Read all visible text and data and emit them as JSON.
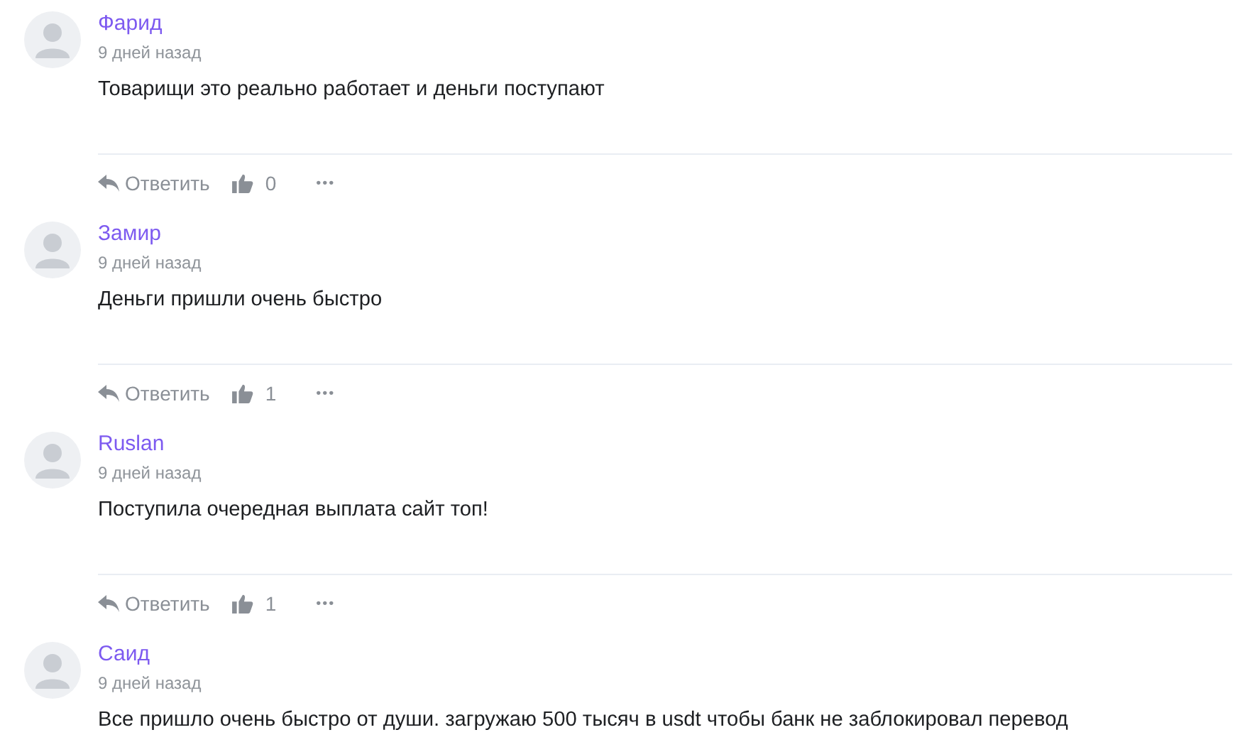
{
  "comments": [
    {
      "author": "Фарид",
      "time": "9 дней назад",
      "text": "Товарищи это реально работает и деньги поступают",
      "actions": {
        "reply": "Ответить",
        "likes": "0",
        "more": "•••"
      }
    },
    {
      "author": "Замир",
      "time": "9 дней назад",
      "text": "Деньги пришли очень быстро",
      "actions": {
        "reply": "Ответить",
        "likes": "1",
        "more": "•••"
      }
    },
    {
      "author": "Ruslan",
      "time": "9 дней назад",
      "text": "Поступила очередная выплата сайт топ!",
      "actions": {
        "reply": "Ответить",
        "likes": "1",
        "more": "•••"
      }
    },
    {
      "author": "Саид",
      "time": "9 дней назад",
      "text": "Все пришло очень быстро от души. загружаю 500 тысяч в usdt чтобы банк не заблокировал перевод"
    }
  ]
}
